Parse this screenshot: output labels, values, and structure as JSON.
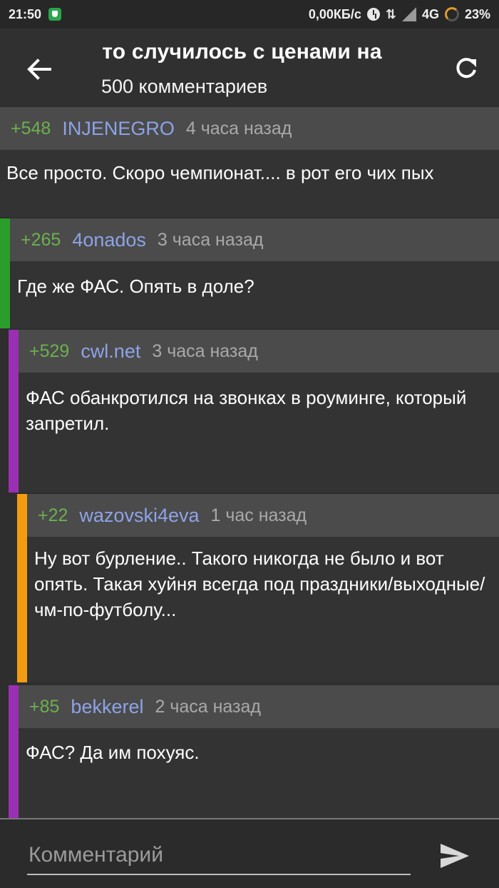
{
  "status_bar": {
    "time": "21:50",
    "net_speed": "0,00КБ/с",
    "network": "4G",
    "battery": "23%"
  },
  "header": {
    "title": "Что случилось с ценами на",
    "subtitle": "500 комментариев",
    "back_icon": "arrow-left-icon",
    "refresh_icon": "refresh-icon"
  },
  "comments": [
    {
      "rating": "+548",
      "author": "INJENEGRO",
      "time": "4 часа назад",
      "text": "Все просто. Скоро чемпионат.... в рот его чих пых",
      "bar_color": ""
    },
    {
      "rating": "+265",
      "author": "4onados",
      "time": "3 часа назад",
      "text": "Где же ФАС. Опять в доле?",
      "bar_color": "#2b9d2b"
    },
    {
      "rating": "+529",
      "author": "cwl.net",
      "time": "3 часа назад",
      "text": "ФАС обанкротился на звонках в роуминге, который запретил.",
      "bar_color": "#9b2fb3"
    },
    {
      "rating": "+22",
      "author": "wazovski4eva",
      "time": "1 час назад",
      "text": "Ну вот бурление.. Такого никогда не было и вот опять. Такая хуйня всегда под праздники/выходные/чм-по-футболу...",
      "bar_color": "#f39c12"
    },
    {
      "rating": "+85",
      "author": "bekkerel",
      "time": "2 часа назад",
      "text": "ФАС? Да им похуяс.",
      "bar_color": "#9b2fb3"
    }
  ],
  "composer": {
    "placeholder": "Комментарий",
    "send_icon": "send-icon"
  },
  "colors": {
    "rating": "#6db04f",
    "author": "#8ea3e6",
    "time": "#a9a9a9",
    "header_bg": "#4b4b4b",
    "body_bg": "#333333"
  }
}
